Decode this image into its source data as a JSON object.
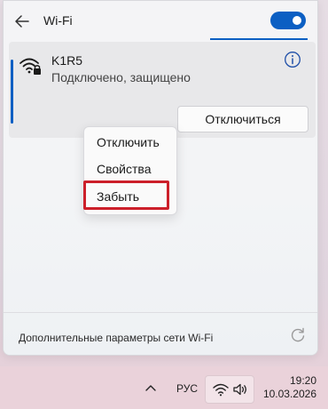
{
  "header": {
    "title": "Wi-Fi",
    "wifi_enabled": true,
    "accent_color": "#0c5fc3"
  },
  "network": {
    "name": "K1R5",
    "status": "Подключено, защищено",
    "disconnect_label": "Отключиться",
    "icon": "wifi-lock-icon"
  },
  "context_menu": {
    "items": [
      {
        "label": "Отключить"
      },
      {
        "label": "Свойства"
      },
      {
        "label": "Забыть",
        "highlighted": true
      }
    ],
    "highlight_color": "#cc1f2a"
  },
  "footer": {
    "link_label": "Дополнительные параметры сети Wi-Fi",
    "refresh_icon": "refresh-icon"
  },
  "taskbar": {
    "language": "РУС",
    "time": "19:20",
    "date": "10.03.2026",
    "icons": [
      "chevron-up-icon",
      "wifi-icon",
      "volume-icon"
    ]
  }
}
